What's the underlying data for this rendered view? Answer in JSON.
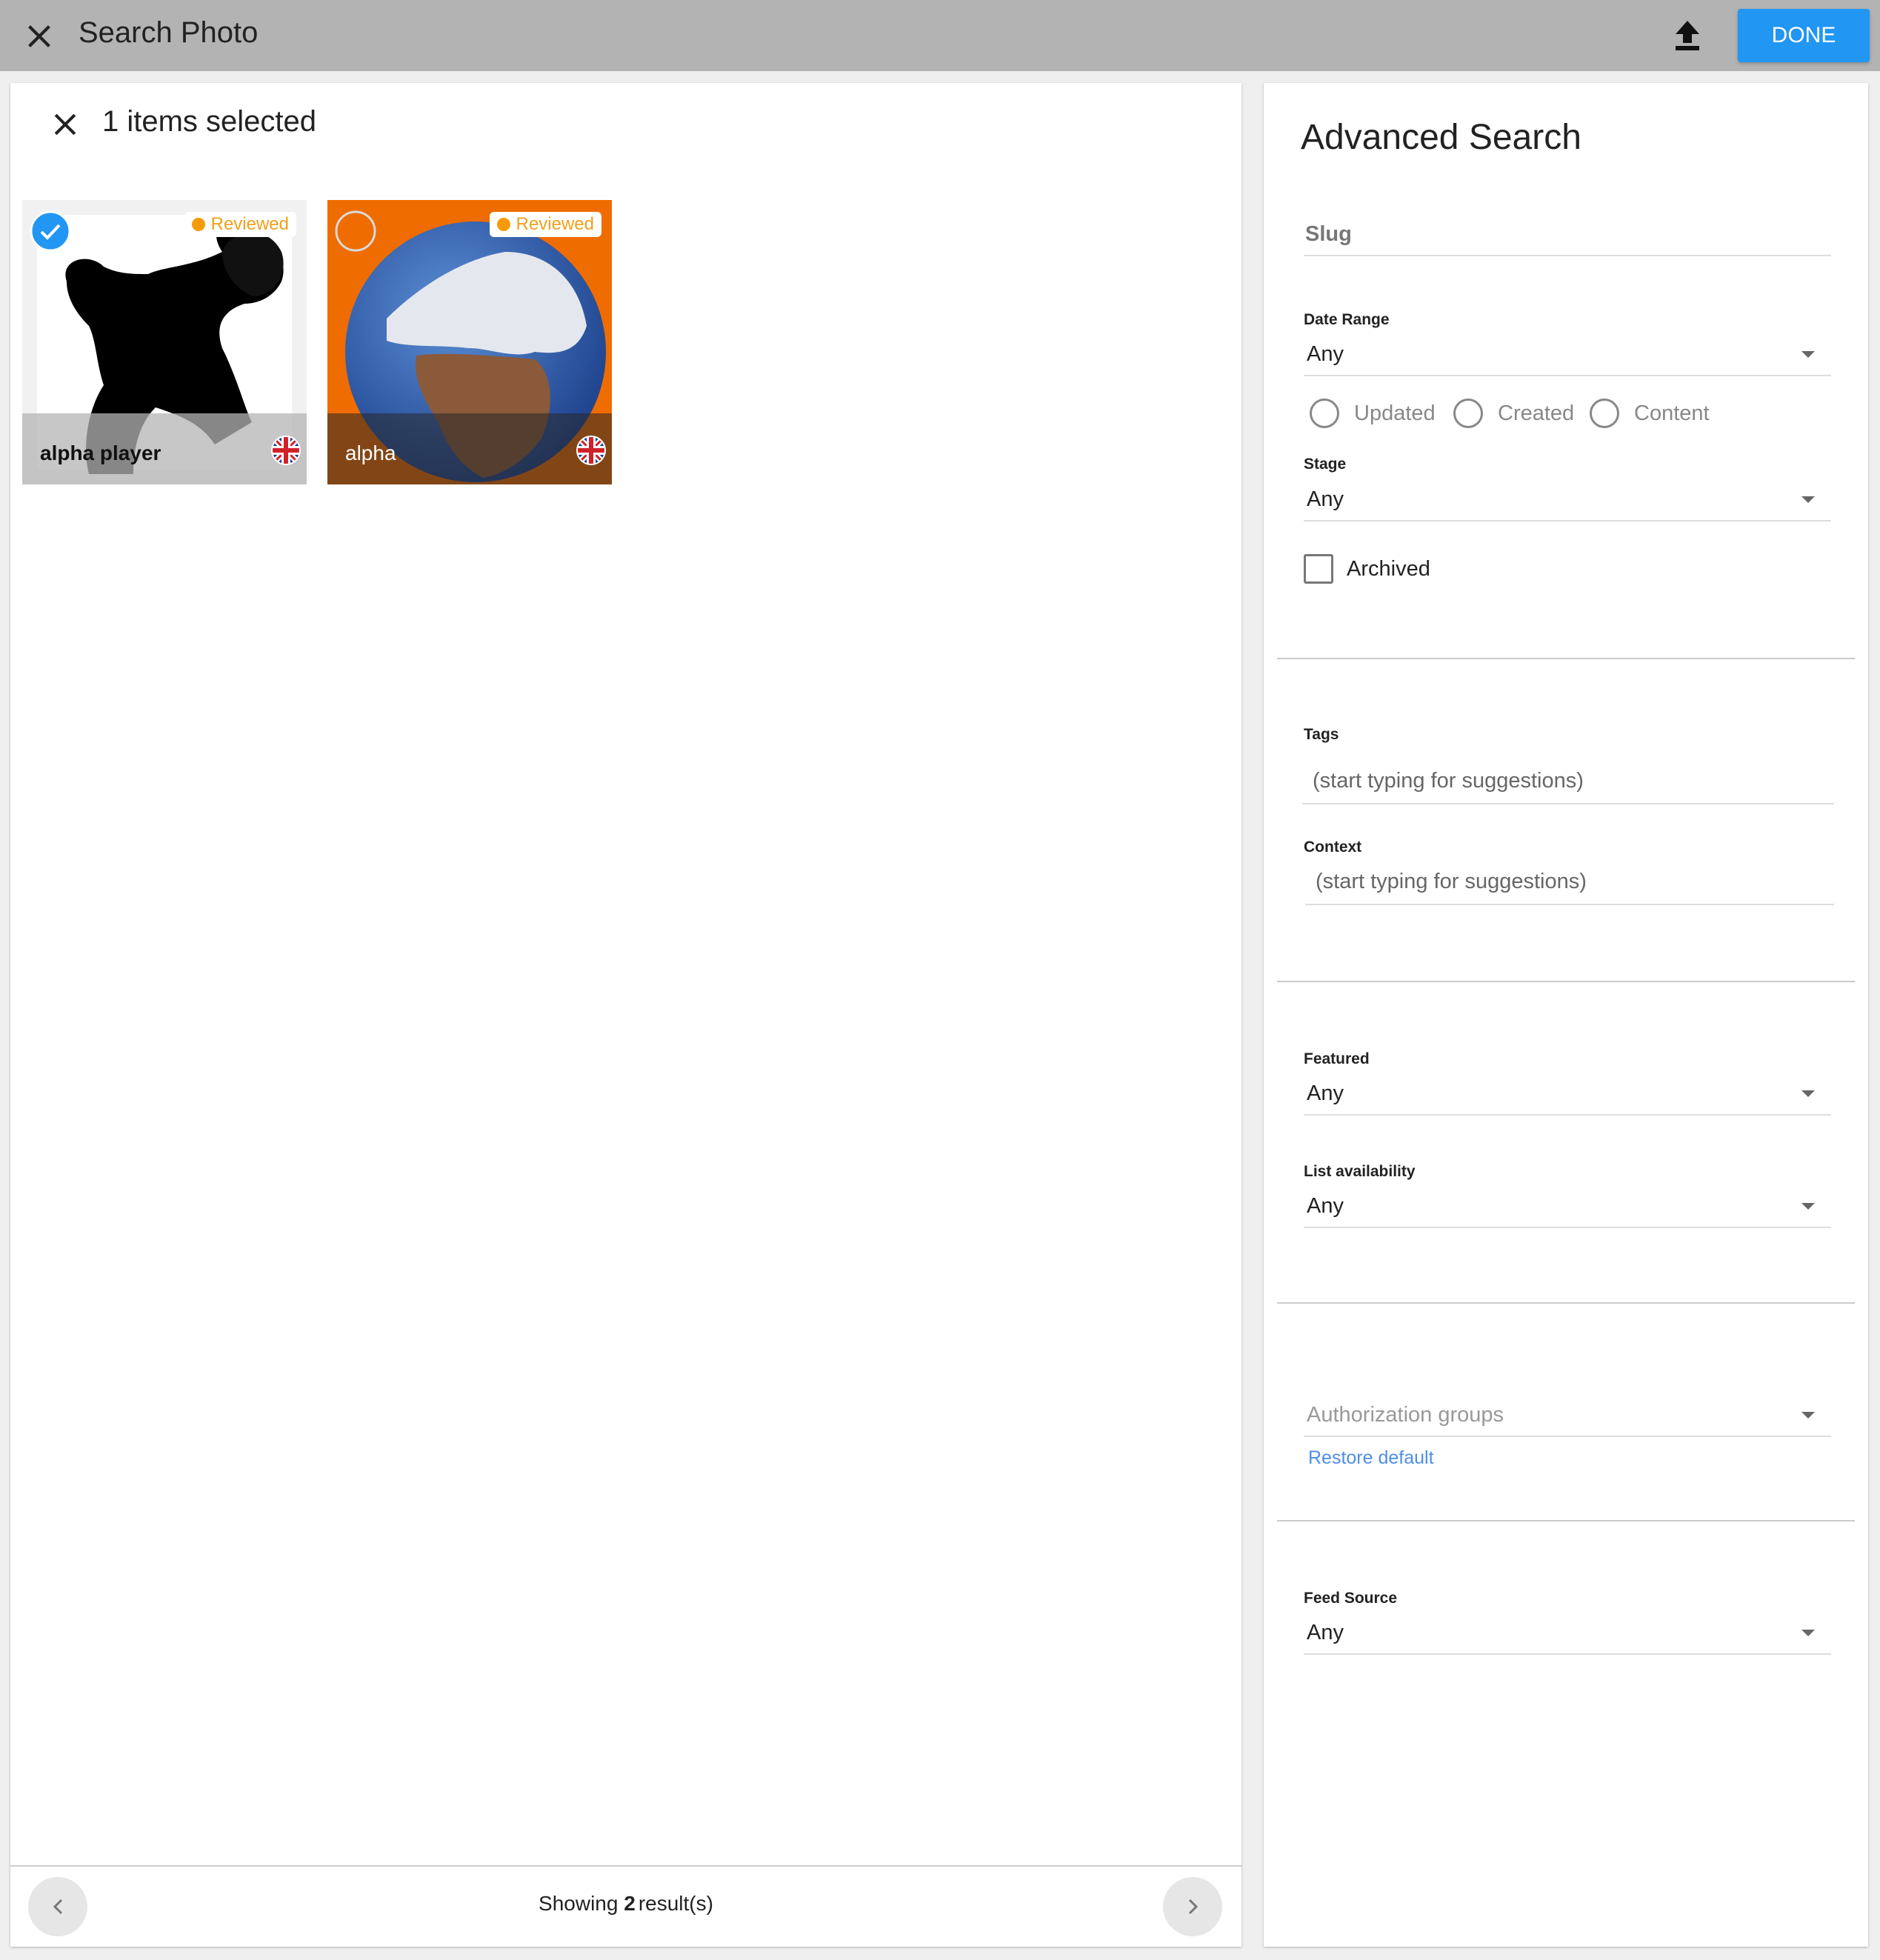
{
  "header": {
    "title": "Search Photo",
    "done_label": "DONE",
    "accent_color": "#2196f3"
  },
  "selection": {
    "text": "1 items selected"
  },
  "results": {
    "items": [
      {
        "caption": "alpha player",
        "badge": "Reviewed",
        "selected": true,
        "language_icon": "uk-flag-icon"
      },
      {
        "caption": "alpha",
        "badge": "Reviewed",
        "selected": false,
        "language_icon": "uk-flag-icon"
      }
    ],
    "showing_prefix": "Showing",
    "showing_count": "2",
    "showing_suffix": "result(s)"
  },
  "advanced": {
    "title": "Advanced Search",
    "slug_placeholder": "Slug",
    "date_range": {
      "label": "Date Range",
      "value": "Any"
    },
    "date_types": [
      "Updated",
      "Created",
      "Content"
    ],
    "stage": {
      "label": "Stage",
      "value": "Any"
    },
    "archived_label": "Archived",
    "tags": {
      "label": "Tags",
      "placeholder": "(start typing for suggestions)"
    },
    "context": {
      "label": "Context",
      "placeholder": "(start typing for suggestions)"
    },
    "featured": {
      "label": "Featured",
      "value": "Any"
    },
    "list_availability": {
      "label": "List availability",
      "value": "Any"
    },
    "authorization_groups": {
      "placeholder": "Authorization groups",
      "restore_label": "Restore default"
    },
    "feed_source": {
      "label": "Feed Source",
      "value": "Any"
    }
  }
}
